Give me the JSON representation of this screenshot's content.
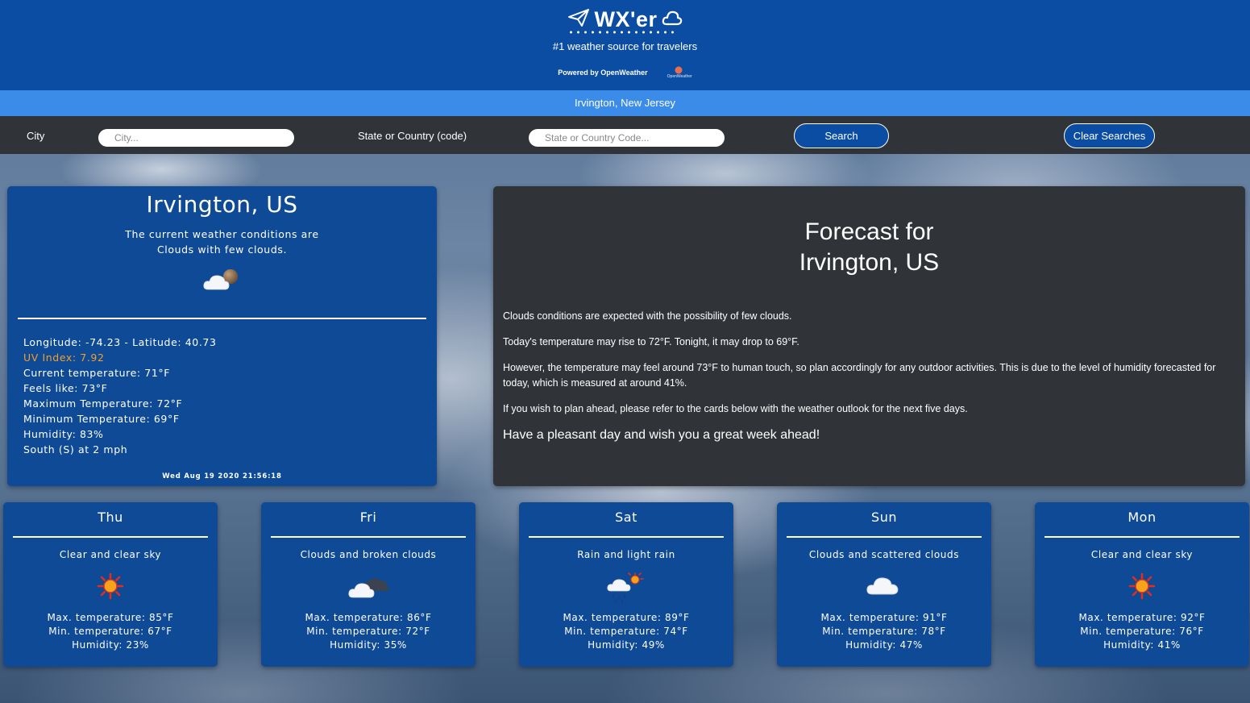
{
  "header": {
    "logo_text": "WX'er",
    "tagline": "#1 weather source for travelers",
    "powered_by": "Powered by OpenWeather",
    "partner_logo_text": "OpenWeather"
  },
  "location_bar": {
    "text": "Irvington, New Jersey"
  },
  "search": {
    "city_label": "City",
    "city_placeholder": "City...",
    "city_value": "",
    "state_label": "State or Country (code)",
    "state_placeholder": "State or Country Code...",
    "state_value": "",
    "search_button": "Search",
    "clear_button": "Clear Searches"
  },
  "current": {
    "city": "Irvington, US",
    "conditions_line1": "The current weather conditions are",
    "conditions_line2": "Clouds with few clouds.",
    "icon": "few-clouds-icon",
    "coords": "Longitude: -74.23 - Latitude: 40.73",
    "uv_index": "UV Index: 7.92",
    "current_temp": "Current temperature: 71°F",
    "feels_like": "Feels like: 73°F",
    "max_temp": "Maximum Temperature: 72°F",
    "min_temp": "Minimum Temperature: 69°F",
    "humidity": "Humidity: 83%",
    "wind": "South (S) at 2 mph",
    "timestamp": "Wed Aug 19 2020 21:56:18",
    "uv_color": "#f0a030"
  },
  "summary": {
    "title_line1": "Forecast for",
    "title_line2": "Irvington, US",
    "p1": "Clouds conditions are expected with the possibility of few clouds.",
    "p2": "Today's temperature may rise to 72°F. Tonight, it may drop to 69°F.",
    "p3": "However, the temperature may feel around 73°F to human touch, so plan accordingly for any outdoor activities. This is due to the level of humidity forecasted for today, which is measured at around 41%.",
    "p4": "If you wish to plan ahead, please refer to the cards below with the weather outlook for the next five days.",
    "closing": "Have a pleasant day and wish you a great week ahead!"
  },
  "forecast": [
    {
      "day": "Thu",
      "conditions": "Clear and clear sky",
      "icon": "sun-icon",
      "max": "Max. temperature: 85°F",
      "min": "Min. temperature: 67°F",
      "humidity": "Humidity: 23%"
    },
    {
      "day": "Fri",
      "conditions": "Clouds and broken clouds",
      "icon": "broken-clouds-icon",
      "max": "Max. temperature: 86°F",
      "min": "Min. temperature: 72°F",
      "humidity": "Humidity: 35%"
    },
    {
      "day": "Sat",
      "conditions": "Rain and light rain",
      "icon": "rain-icon",
      "max": "Max. temperature: 89°F",
      "min": "Min. temperature: 74°F",
      "humidity": "Humidity: 49%"
    },
    {
      "day": "Sun",
      "conditions": "Clouds and scattered clouds",
      "icon": "scattered-clouds-icon",
      "max": "Max. temperature: 91°F",
      "min": "Min. temperature: 78°F",
      "humidity": "Humidity: 47%"
    },
    {
      "day": "Mon",
      "conditions": "Clear and clear sky",
      "icon": "sun-icon",
      "max": "Max. temperature: 92°F",
      "min": "Min. temperature: 76°F",
      "humidity": "Humidity: 41%"
    }
  ],
  "colors": {
    "header_bg": "#0a4da3",
    "location_bar_bg": "#3a8ce8",
    "search_bar_bg": "#303338",
    "card_bg": "#0e4a96",
    "summary_bg": "#303338"
  }
}
